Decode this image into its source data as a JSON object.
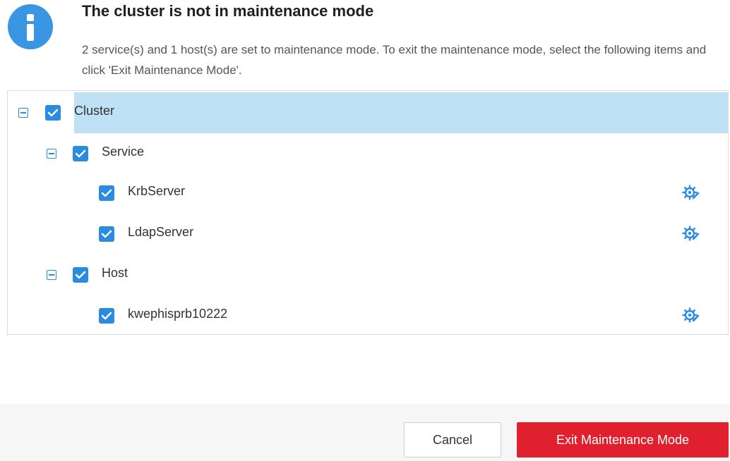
{
  "header": {
    "icon": "info-icon",
    "icon_color": "#3a95e3",
    "title": "The cluster is not in maintenance mode",
    "description": "2 service(s) and 1 host(s) are set to maintenance mode. To exit the maintenance mode, select the following items and click 'Exit Maintenance Mode'."
  },
  "tree": {
    "accent_color": "#2a8be0",
    "highlight_color": "#bfe1f5",
    "cluster": {
      "label": "Cluster",
      "checked": true,
      "expanded": true,
      "selected": true
    },
    "service": {
      "label": "Service",
      "checked": true,
      "expanded": true
    },
    "services": [
      {
        "label": "KrbServer",
        "checked": true,
        "icon": "maintenance-gear-icon"
      },
      {
        "label": "LdapServer",
        "checked": true,
        "icon": "maintenance-gear-icon"
      }
    ],
    "host": {
      "label": "Host",
      "checked": true,
      "expanded": true
    },
    "hosts": [
      {
        "label": "kwephisprb10222",
        "checked": true,
        "icon": "maintenance-gear-icon"
      }
    ]
  },
  "footer": {
    "cancel_label": "Cancel",
    "exit_label": "Exit Maintenance Mode",
    "exit_color": "#e0202e"
  }
}
